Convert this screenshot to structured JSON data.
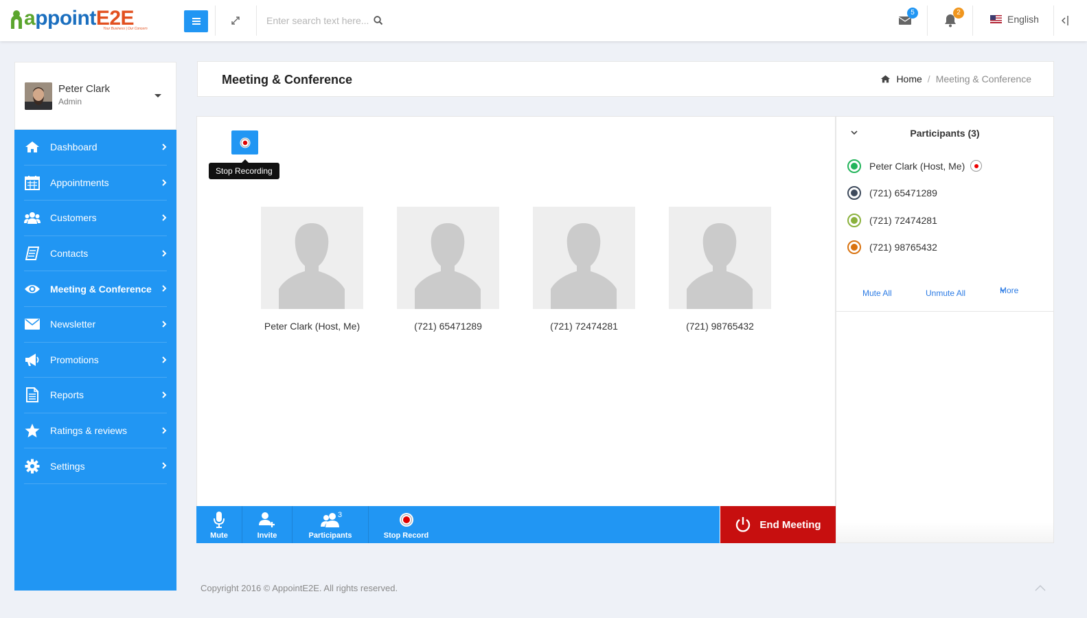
{
  "app": {
    "logo_text_a": "a",
    "logo_text_ppoint": "ppoint",
    "logo_text_e2e": "E2E",
    "logo_tagline": "Your Business | Our Concern"
  },
  "topbar": {
    "search_placeholder": "Enter search text here...",
    "messages_count": "5",
    "notifications_count": "2",
    "language": "English",
    "colors": {
      "accent": "#2196f3",
      "messages_badge": "#2196f3",
      "notifications_badge": "#f0961e"
    }
  },
  "user": {
    "name": "Peter Clark",
    "role": "Admin"
  },
  "sidebar": {
    "items": [
      {
        "label": "Dashboard",
        "icon": "home-icon"
      },
      {
        "label": "Appointments",
        "icon": "calendar-icon"
      },
      {
        "label": "Customers",
        "icon": "users-icon"
      },
      {
        "label": "Contacts",
        "icon": "address-book-icon"
      },
      {
        "label": "Meeting & Conference",
        "icon": "eye-icon",
        "active": true
      },
      {
        "label": "Newsletter",
        "icon": "envelope-icon"
      },
      {
        "label": "Promotions",
        "icon": "bullhorn-icon"
      },
      {
        "label": "Reports",
        "icon": "document-icon"
      },
      {
        "label": "Ratings & reviews",
        "icon": "star-icon"
      },
      {
        "label": "Settings",
        "icon": "gear-icon"
      }
    ]
  },
  "page": {
    "title": "Meeting & Conference",
    "breadcrumb_home": "Home",
    "breadcrumb_sep": "/",
    "breadcrumb_current": "Meeting & Conference"
  },
  "meeting": {
    "record_tooltip": "Stop Recording",
    "tiles": [
      {
        "name": "Peter Clark (Host, Me)"
      },
      {
        "name": "(721) 65471289"
      },
      {
        "name": "(721) 72474281"
      },
      {
        "name": "(721) 98765432"
      }
    ],
    "toolbar": {
      "mute": "Mute",
      "invite": "Invite",
      "participants": "Participants",
      "participants_count": "3",
      "stop_record": "Stop Record"
    },
    "end_meeting": "End Meeting",
    "colors": {
      "end_meeting": "#c70f0f",
      "record_dot": "#e00000"
    }
  },
  "participants_panel": {
    "title": "Participants (3)",
    "items": [
      {
        "name": "Peter Clark (Host, Me)",
        "color": "#22b45a",
        "recording": true
      },
      {
        "name": "(721) 65471289",
        "color": "#3e4a5c",
        "recording": false
      },
      {
        "name": "(721) 72474281",
        "color": "#8ab13c",
        "recording": false
      },
      {
        "name": "(721) 98765432",
        "color": "#d9720f",
        "recording": false
      }
    ],
    "mute_all": "Mute All",
    "unmute_all": "Unmute All",
    "more": "More"
  },
  "footer": {
    "copyright": "Copyright 2016 © AppointE2E. All rights reserved."
  }
}
